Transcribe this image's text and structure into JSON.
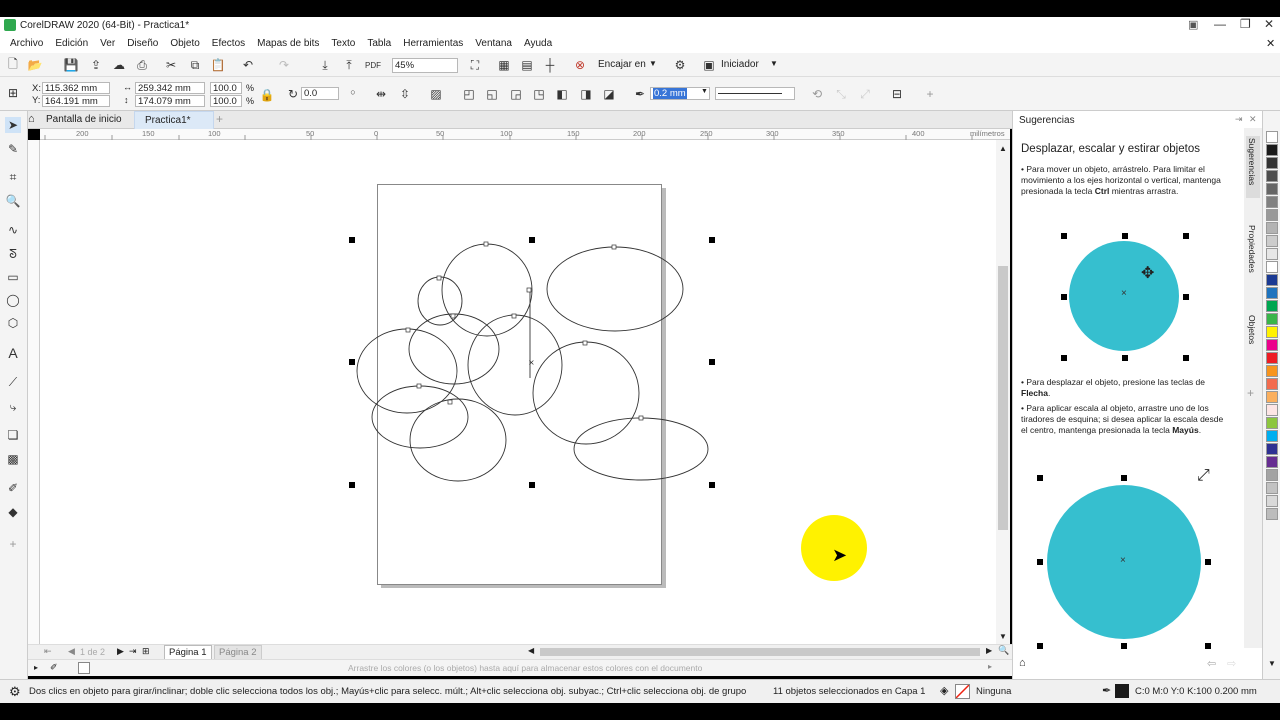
{
  "window": {
    "title": "CorelDRAW 2020 (64-Bit) - Practica1*"
  },
  "menu": [
    "Archivo",
    "Edición",
    "Ver",
    "Diseño",
    "Objeto",
    "Efectos",
    "Mapas de bits",
    "Texto",
    "Tabla",
    "Herramientas",
    "Ventana",
    "Ayuda"
  ],
  "toolbar": {
    "zoom": "45%",
    "snap_label": "Encajar en",
    "launch_label": "Iniciador"
  },
  "propbar": {
    "x": "115.362 mm",
    "y": "164.191 mm",
    "w": "259.342 mm",
    "h": "174.079 mm",
    "sx": "100.0",
    "sy": "100.0",
    "pct": "%",
    "x_label": "X:",
    "y_label": "Y:",
    "rotation": "0.0",
    "outline_width": "0.2 mm"
  },
  "tabs": {
    "home": "Pantalla de inicio",
    "doc": "Practica1*",
    "add": "+"
  },
  "ruler": {
    "labels": [
      "200",
      "150",
      "100",
      "50",
      "0",
      "50",
      "100",
      "150",
      "200",
      "250",
      "300",
      "350",
      "400"
    ],
    "unit": "milímetros"
  },
  "pages": {
    "counter": "1 de 2",
    "page1": "Página 1",
    "page2": "Página 2"
  },
  "palette_hint": "Arrastre los colores (o los objetos) hasta aquí para almacenar estos colores con el documento",
  "status": {
    "hint": "Dos clics en objeto para girar/inclinar; doble clic selecciona todos los obj.; Mayús+clic para selecc. múlt.; Alt+clic selecciona obj. subyac.; Ctrl+clic selecciona obj. de grupo",
    "selection": "11 objetos seleccionados en Capa 1",
    "fill": "Ninguna",
    "outline": "C:0 M:0 Y:0 K:100  0.200 mm"
  },
  "docker": {
    "title": "Sugerencias",
    "heading": "Desplazar, escalar y estirar objetos",
    "p1_before": "Para mover un objeto, arrástrelo. Para limitar el movimiento a los ejes horizontal o vertical, mantenga presionada la tecla ",
    "p1_key": "Ctrl",
    "p1_after": " mientras arrastra.",
    "p2_before": "Para desplazar el objeto, presione las teclas de ",
    "p2_key": "Flecha",
    "p2_after": ".",
    "p3_before": "Para aplicar escala al objeto, arrastre uno de los tiradores de esquina; si desea aplicar la escala desde el centro, mantenga presionada la tecla ",
    "p3_key": "Mayús",
    "p3_after": ".",
    "side_tabs": [
      "Sugerencias",
      "Propiedades",
      "Objetos"
    ]
  },
  "colors": {
    "accent": "#36BFCF",
    "cursor_highlight": "#FFF200",
    "palette": [
      "#ffffff",
      "#1a1a1a",
      "#333333",
      "#4d4d4d",
      "#666666",
      "#808080",
      "#999999",
      "#b3b3b3",
      "#cccccc",
      "#e6e6e6",
      "#ffffff",
      "#1b3a93",
      "#1e73be",
      "#00a651",
      "#39b54a",
      "#fff200",
      "#ec008c",
      "#ed1c24",
      "#f7941d",
      "#f26c4f",
      "#fbaf5d",
      "#fde5e5",
      "#8dc63f",
      "#00aeef",
      "#2e3192",
      "#662d91",
      "#a3a3a3",
      "#c2c2c2",
      "#d9d9d9",
      "#bcbcbc"
    ]
  }
}
